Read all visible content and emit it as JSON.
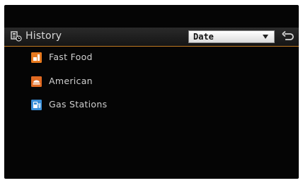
{
  "header": {
    "title": "History",
    "icon": "history-poi-icon",
    "sort": {
      "selected": "Date"
    },
    "back_icon": "back-arrow-icon"
  },
  "list": {
    "items": [
      {
        "label": "Fast Food",
        "icon": "fast-food-icon",
        "color": "#e87a1f"
      },
      {
        "label": "American",
        "icon": "restaurant-icon",
        "color": "#e06a22"
      },
      {
        "label": "Gas Stations",
        "icon": "gas-station-icon",
        "color": "#3a8fd8"
      }
    ]
  },
  "colors": {
    "background": "#050505",
    "accent": "#c07a22",
    "text": "#cfcfcf"
  }
}
